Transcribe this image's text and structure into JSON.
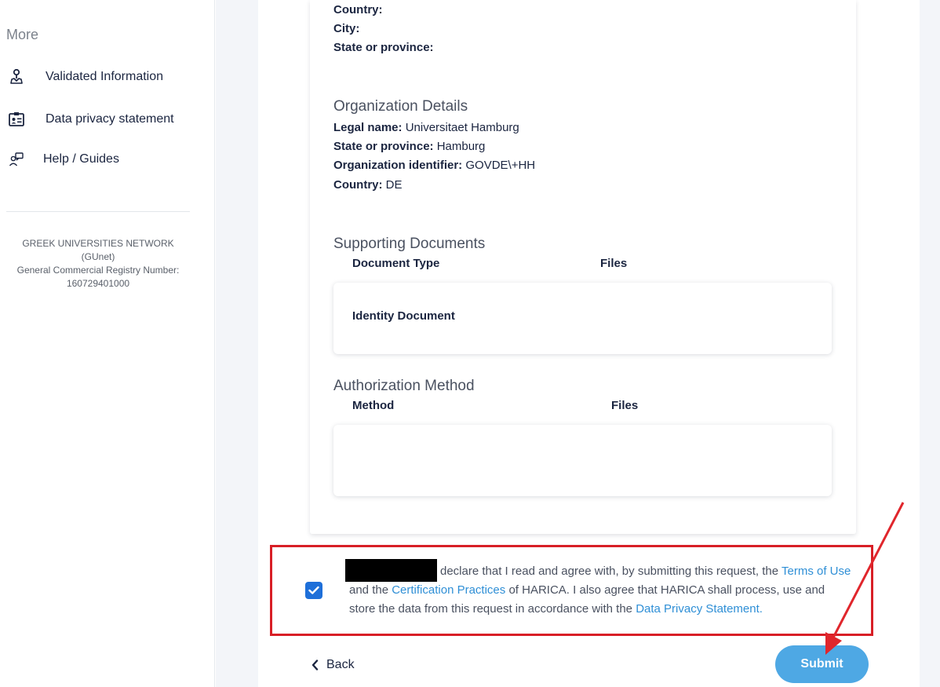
{
  "sidebar": {
    "more_title": "More",
    "items": [
      {
        "label": "Validated Information",
        "icon": "badge-ribbon-icon"
      },
      {
        "label": "Data privacy statement",
        "icon": "id-card-icon"
      },
      {
        "label": "Help / Guides",
        "icon": "help-desk-icon"
      }
    ],
    "org": {
      "name": "GREEK UNIVERSITIES NETWORK",
      "short": "(GUnet)",
      "registry_label": "General Commercial Registry Number:",
      "registry_number": "160729401000"
    }
  },
  "address": {
    "country_label": "Country:",
    "city_label": "City:",
    "state_label": "State or province:"
  },
  "organization": {
    "title": "Organization Details",
    "legal_name_label": "Legal name:",
    "legal_name": "Universitaet Hamburg",
    "state_label": "State or province:",
    "state": "Hamburg",
    "identifier_label": "Organization identifier:",
    "identifier": "GOVDE\\+HH",
    "country_label": "Country:",
    "country": "DE"
  },
  "supporting_documents": {
    "title": "Supporting Documents",
    "col_type": "Document Type",
    "col_files": "Files",
    "rows": [
      {
        "type": "Identity Document"
      }
    ]
  },
  "authorization": {
    "title": "Authorization Method",
    "col_method": "Method",
    "col_files": "Files"
  },
  "agreement": {
    "checked": true,
    "text_1": "declare that I read and agree with, by submitting this request, the ",
    "link_terms": "Terms of Use",
    "text_2": " and the ",
    "link_cps": "Certification Practices",
    "text_3": " of HARICA. I also agree that HARICA shall process, use and store the data from this request in accordance with the ",
    "link_privacy": "Data Privacy Statement."
  },
  "actions": {
    "back_label": "Back",
    "submit_label": "Submit"
  },
  "colors": {
    "checkbox": "#1e6fd9",
    "submit": "#4ea8e4",
    "link": "#2f8fd6",
    "highlight": "#d81f26"
  }
}
